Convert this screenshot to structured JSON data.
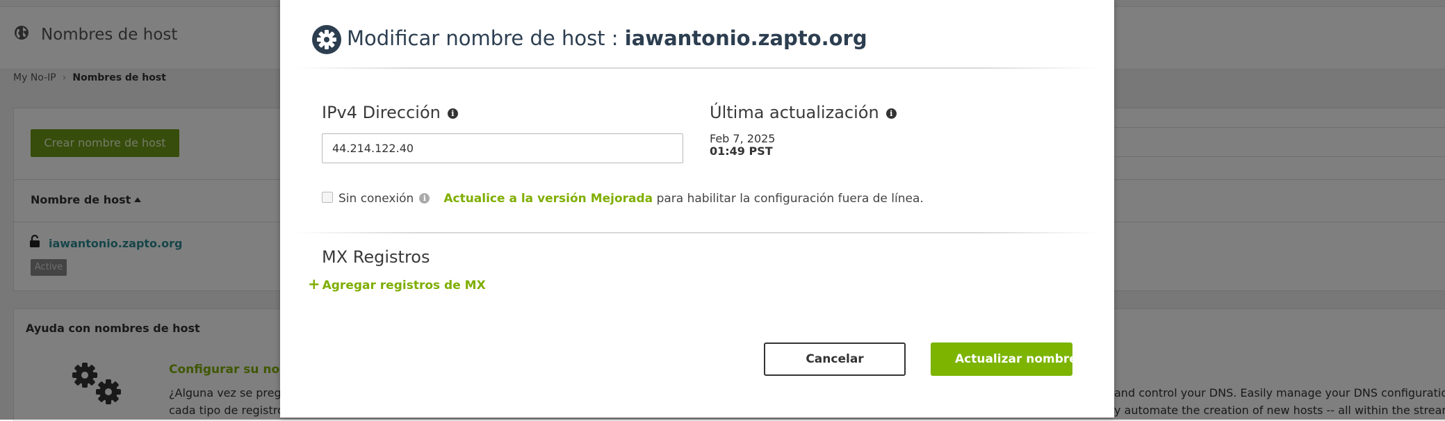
{
  "page": {
    "title": "Nombres de host",
    "breadcrumb": {
      "root": "My No-IP",
      "current": "Nombres de host"
    },
    "create_button": "Crear nombre de host",
    "table": {
      "column_header": "Nombre de host",
      "rows": [
        {
          "hostname": "iawantonio.zapto.org",
          "status": "Active"
        }
      ]
    },
    "help": {
      "title": "Ayuda con nombres de host",
      "link": "Configurar su nomb",
      "text_line1": "¿Alguna vez se pregu",
      "text_line2": "cada tipo de registro",
      "right_line1": "and control your DNS. Easily manage your DNS configuration",
      "right_line2": "y automate the creation of new hosts -- all within the streamli"
    }
  },
  "modal": {
    "title_prefix": "Modificar nombre de host",
    "title_separator": ":",
    "hostname": "iawantonio.zapto.org",
    "ipv4": {
      "label": "IPv4 Dirección",
      "value": "44.214.122.40",
      "info_icon": "info-icon"
    },
    "last_update": {
      "label": "Última actualización",
      "date": "Feb 7, 2025",
      "time": "01:49 PST",
      "info_icon": "info-icon"
    },
    "offline": {
      "label": "Sin conexión",
      "checked": false,
      "upgrade_link": "Actualice a la versión Mejorada",
      "upgrade_suffix": "para habilitar la configuración fuera de línea."
    },
    "mx": {
      "title": "MX Registros",
      "add_label": "Agregar registros de MX"
    },
    "buttons": {
      "cancel": "Cancelar",
      "update": "Actualizar nombre de"
    }
  },
  "colors": {
    "accent_green": "#7cb400",
    "link_green": "#7fae00",
    "create_button_bg": "#6f9a16",
    "host_link": "#2d8a93",
    "overlay": "rgba(0,0,0,0.5)"
  },
  "icons": [
    "globe-icon",
    "lock-icon",
    "gears-icon",
    "gear-icon",
    "info-icon",
    "plus-icon"
  ]
}
